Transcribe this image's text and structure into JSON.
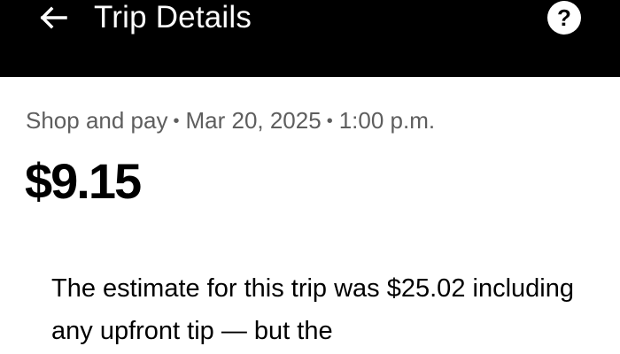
{
  "header": {
    "title": "Trip Details",
    "back_icon": "arrow-left-icon",
    "help_icon": "question-mark-icon",
    "help_glyph": "?",
    "background": "#000000",
    "foreground": "#ffffff"
  },
  "trip": {
    "service": "Shop and pay",
    "separator": "•",
    "date": "Mar 20, 2025",
    "time": "1:00 p.m.",
    "total": "$9.15",
    "explanation": "The estimate for this trip was $25.02 including any upfront tip — but the"
  }
}
